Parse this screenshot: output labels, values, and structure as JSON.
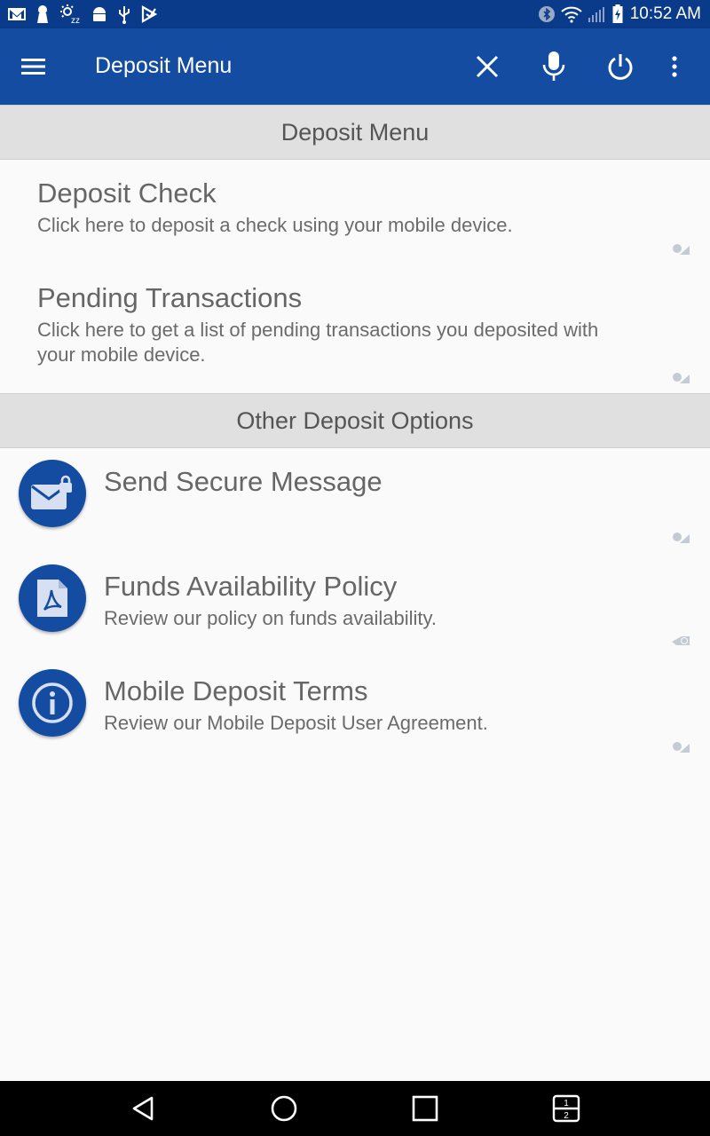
{
  "status_bar": {
    "time": "10:52 AM",
    "left_icons": [
      "gmail-icon",
      "keyhole-icon",
      "sleep-icon",
      "android-debug-icon",
      "usb-icon",
      "play-store-icon"
    ],
    "right_icons": [
      "bluetooth-icon",
      "wifi-icon",
      "signal-icon",
      "battery-charging-icon"
    ]
  },
  "app_bar": {
    "title": "Deposit Menu",
    "actions": [
      "close-icon",
      "microphone-icon",
      "power-icon",
      "more-vert-icon"
    ]
  },
  "sections": {
    "deposit_menu_header": "Deposit Menu",
    "other_options_header": "Other Deposit Options"
  },
  "deposit_items": [
    {
      "title": "Deposit Check",
      "subtitle": "Click here to deposit a check using your mobile device."
    },
    {
      "title": "Pending Transactions",
      "subtitle_line1": "Click here to get a list of pending transactions you deposited with",
      "subtitle_line2": "your mobile device."
    }
  ],
  "other_items": [
    {
      "title": "Send Secure Message",
      "icon": "secure-mail-icon"
    },
    {
      "title": "Funds Availability Policy",
      "subtitle": "Review our policy on funds availability.",
      "icon": "pdf-icon"
    },
    {
      "title": "Mobile Deposit Terms",
      "subtitle": "Review our Mobile Deposit User Agreement.",
      "icon": "info-icon"
    }
  ],
  "nav_bar": {
    "buttons": [
      "back-icon",
      "home-icon",
      "recents-icon",
      "split-screen-icon"
    ],
    "split_label_top": "1",
    "split_label_bottom": "2"
  },
  "colors": {
    "status_bar": "#0a3a8a",
    "app_bar": "#134ca0",
    "section_header": "#e0e0e0",
    "background": "#fafafa"
  }
}
